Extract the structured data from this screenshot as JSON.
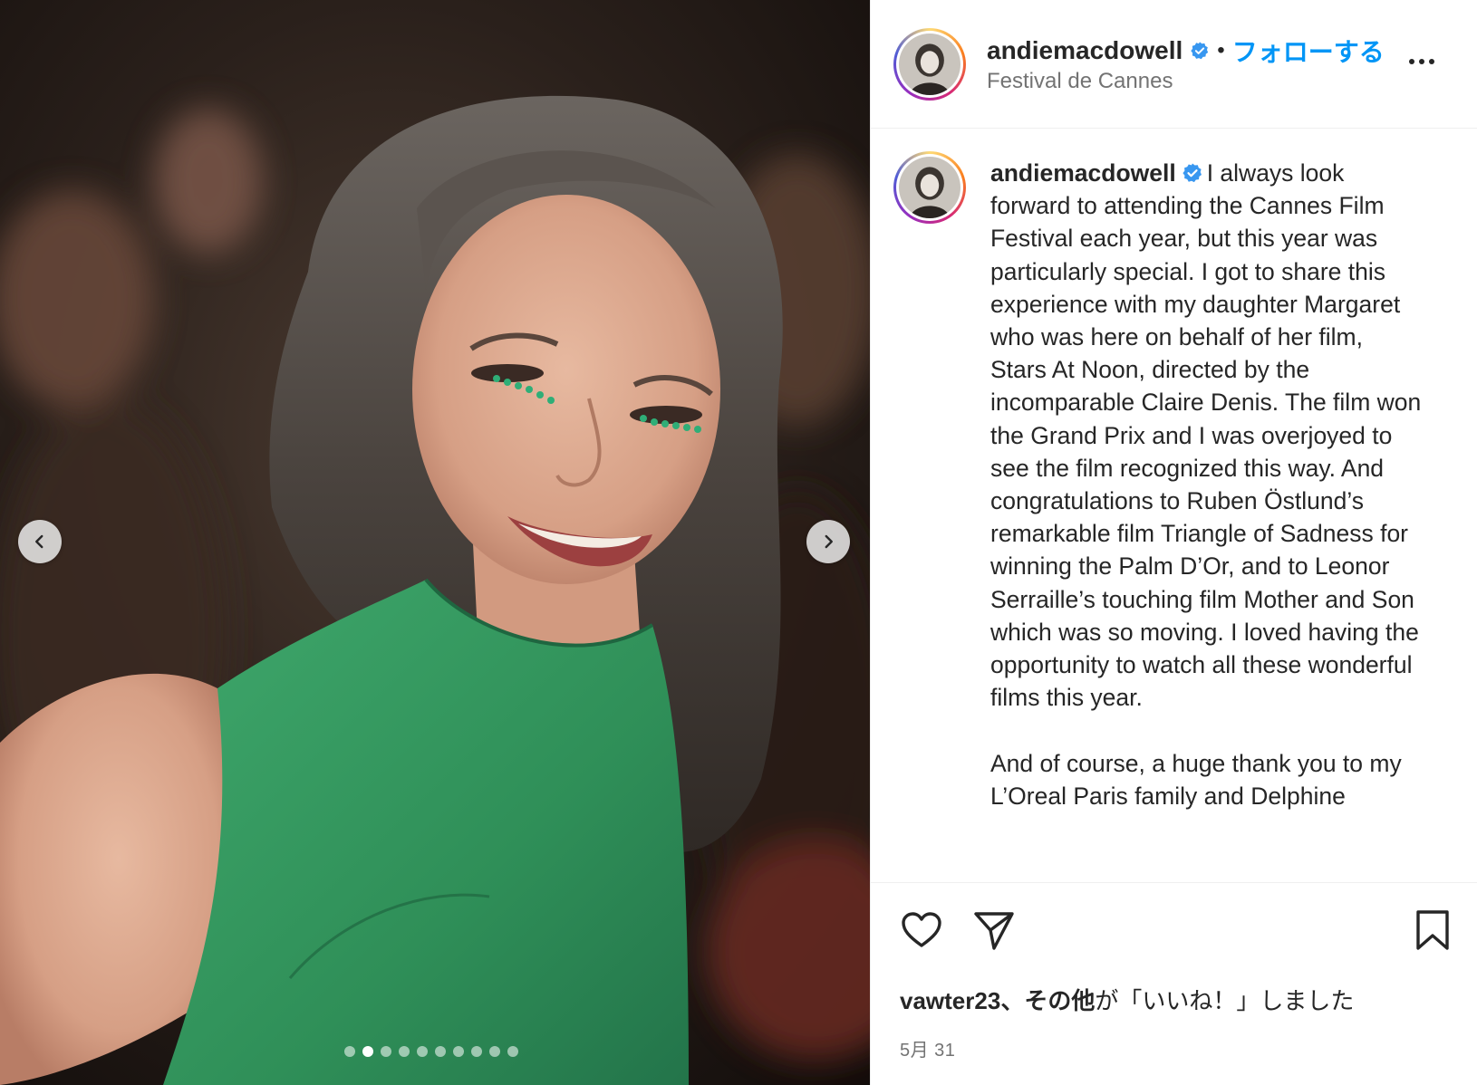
{
  "header": {
    "username": "andiemacdowell",
    "separator": "•",
    "follow_label": "フォローする",
    "location": "Festival de Cannes",
    "more_icon": "more-horizontal-icon"
  },
  "media": {
    "image_alt": "Woman with grey wavy hair, green jeweled eyeliner, green sleeveless dress, smiling on red carpet",
    "prev_icon": "chevron-left-icon",
    "next_icon": "chevron-right-icon",
    "carousel_count": 10,
    "carousel_active_index": 1
  },
  "caption": {
    "username": "andiemacdowell",
    "text": "I always look forward to attending the Cannes Film Festival each year, but this year was particularly special. I got to share this experience with my daughter Margaret who was here on behalf of her film, Stars At Noon, directed by the incomparable Claire Denis. The film won the Grand Prix and I was overjoyed to see the film recognized this way. And congratulations to Ruben Östlund’s remarkable film Triangle of Sadness for winning the Palm D’Or, and to Leonor Serraille’s touching film Mother and Son which was so moving. I loved having the opportunity to watch all these wonderful films this year.\n\nAnd of course, a huge thank you to my L’Oreal Paris family and Delphine"
  },
  "actions": {
    "like_icon": "heart-icon",
    "share_icon": "paper-plane-icon",
    "save_icon": "bookmark-icon",
    "likes_user": "vawter23",
    "likes_middle": "、その他",
    "likes_suffix": "が「いいね！」しました",
    "date": "5月 31"
  },
  "colors": {
    "accent": "#0095f6",
    "verified": "#3897f0",
    "text": "#262626",
    "muted": "#737373"
  }
}
